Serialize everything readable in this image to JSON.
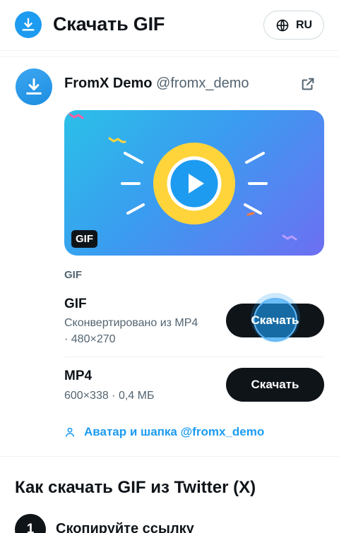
{
  "header": {
    "title": "Скачать GIF",
    "lang": "RU"
  },
  "post": {
    "author_name": "FromX Demo",
    "author_handle": "@fromx_demo",
    "media_badge": "GIF"
  },
  "formats_label": "GIF",
  "formats": [
    {
      "name": "GIF",
      "line1": "Сконвертировано из MP4",
      "line2": "· 480×270",
      "button": "Скачать"
    },
    {
      "name": "MP4",
      "line1": "600×338 · 0,4 МБ",
      "button": "Скачать"
    }
  ],
  "profile_link": "Аватар и шапка @fromx_demo",
  "howto": {
    "title": "Как скачать GIF из Twitter (X)",
    "steps": [
      {
        "num": "1",
        "text": "Скопируйте ссылку"
      }
    ]
  },
  "colors": {
    "accent": "#1d9bf0",
    "text": "#0f1419",
    "muted": "#536471",
    "button": "#0f1419"
  }
}
